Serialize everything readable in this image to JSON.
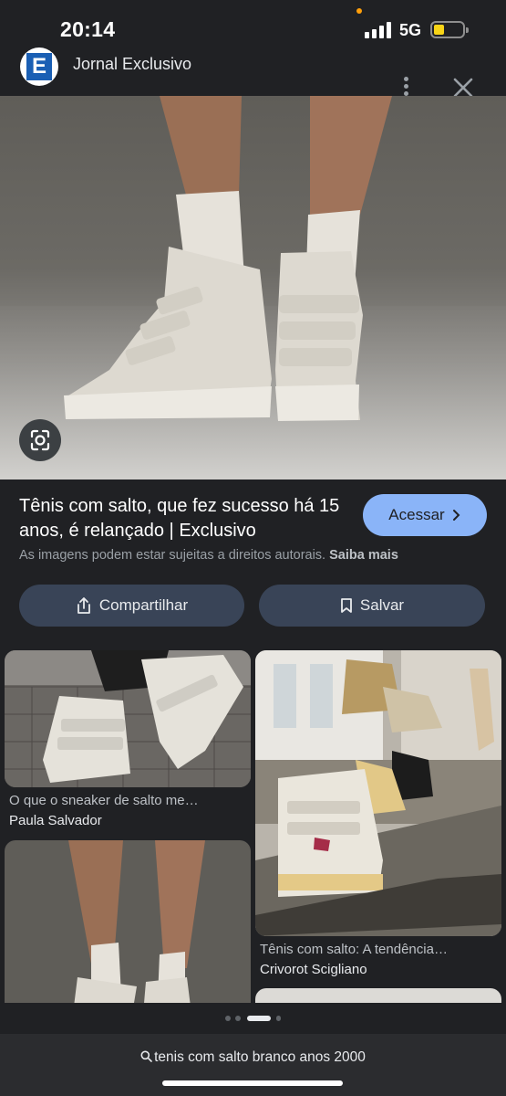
{
  "status_bar": {
    "time": "20:14",
    "network": "5G"
  },
  "header": {
    "source_name": "Jornal Exclusivo",
    "logo_letter": "E"
  },
  "result": {
    "title": "Tênis com salto, que fez sucesso há 15 anos, é relançado | Exclusivo",
    "access_label": "Acessar",
    "copyright_text": "As imagens podem estar sujeitas a direitos autorais.",
    "learn_more_label": "Saiba mais",
    "share_label": "Compartilhar",
    "save_label": "Salvar"
  },
  "related": [
    {
      "caption": "O que o sneaker de salto me…",
      "source": "Paula Salvador"
    },
    {
      "caption": "Tênis com salto: A tendência…",
      "source": "Crivorot Scigliano"
    }
  ],
  "search": {
    "query": "tenis com salto branco anos 2000"
  },
  "colors": {
    "accent": "#8ab4f8",
    "button_bg": "#394457",
    "background": "#202124"
  }
}
